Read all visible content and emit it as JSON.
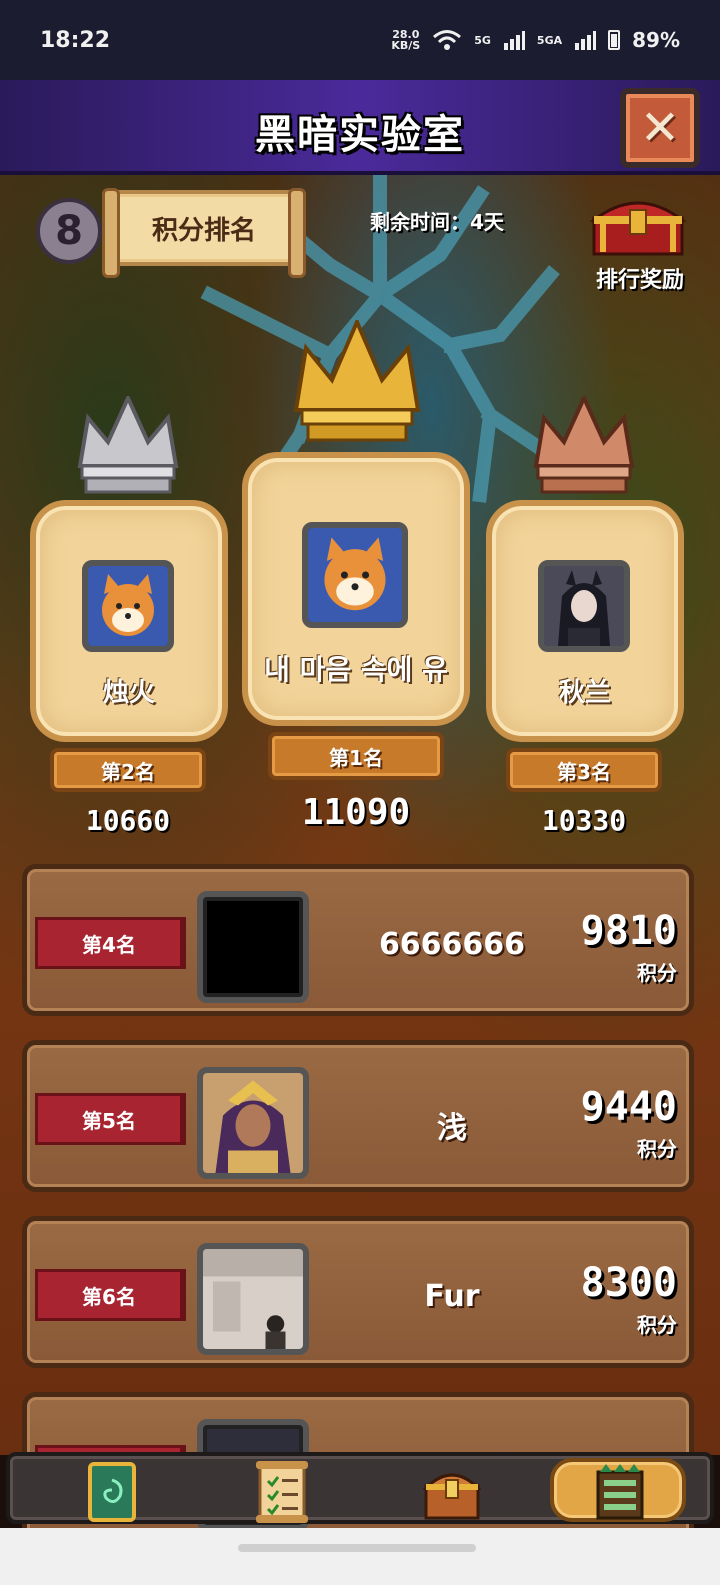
{
  "status_bar": {
    "time": "18:22",
    "net_speed": "28.0",
    "net_speed_unit": "KB/S",
    "sig1": "5G",
    "sig2": "5GA",
    "battery": "89%"
  },
  "header": {
    "title": "黑暗实验室"
  },
  "toolbar": {
    "badge": "8",
    "tab_label": "积分排名",
    "remaining_time": "剩余时间：4天",
    "reward_label": "排行奖励"
  },
  "podium": [
    {
      "rank_label": "第2名",
      "name": "烛火",
      "score": "10660"
    },
    {
      "rank_label": "第1名",
      "name": "내 마음 속에 유",
      "score": "11090"
    },
    {
      "rank_label": "第3名",
      "name": "秋兰",
      "score": "10330"
    }
  ],
  "ranking_rows": [
    {
      "rank_label": "第4名",
      "name": "6666666",
      "score": "9810",
      "unit": "积分"
    },
    {
      "rank_label": "第5名",
      "name": "浅",
      "score": "9440",
      "unit": "积分"
    },
    {
      "rank_label": "第6名",
      "name": "Fur",
      "score": "8300",
      "unit": "积分"
    }
  ],
  "colors": {
    "gold": "#e8b43a",
    "silver": "#c8c8cc",
    "bronze": "#d08a6a",
    "ribbon": "#a82430",
    "title_bar": "#4a2a9a"
  }
}
